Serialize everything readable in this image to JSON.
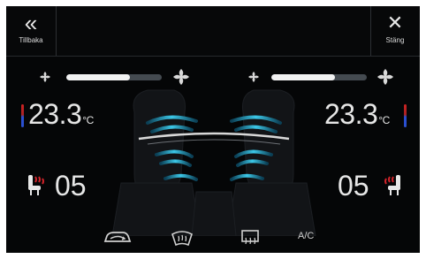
{
  "topbar": {
    "back_label": "Tillbaka",
    "close_label": "Stäng"
  },
  "fan": {
    "left_level": 0.67,
    "right_level": 0.67
  },
  "driver": {
    "temperature": "23.3",
    "unit": "°C",
    "seat_heat": "05"
  },
  "passenger": {
    "temperature": "23.3",
    "unit": "°C",
    "seat_heat": "05"
  },
  "bottom": {
    "ac_label": "A/C"
  },
  "icons": {
    "back": "chevron-double-left-icon",
    "close": "close-icon",
    "fan_small": "fan-small-icon",
    "fan_large": "fan-large-icon",
    "seat_heat": "heated-seat-icon",
    "recirculation": "recirculation-icon",
    "front_defrost": "front-defrost-icon",
    "rear_defrost": "rear-defrost-icon"
  },
  "colors": {
    "background": "#050607",
    "airflow": "#2bb6d8",
    "seat_heat": "#d2232a",
    "hot": "#c22222",
    "cold": "#2a4fd0"
  }
}
